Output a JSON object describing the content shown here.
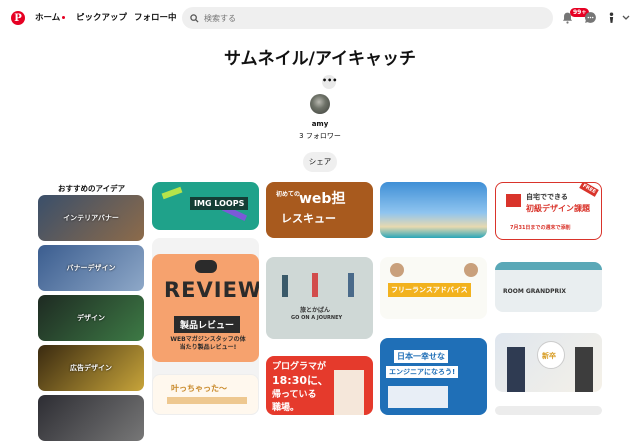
{
  "header": {
    "logo": "P",
    "nav": [
      "ホーム",
      "ピックアップ",
      "フォロー中"
    ],
    "search_placeholder": "検索する",
    "notification_count": "99+"
  },
  "board": {
    "title": "サムネイル/アイキャッチ",
    "more_label": "•••",
    "owner": "amy",
    "followers": "3 フォロワー",
    "share_label": "シェア"
  },
  "ideas": {
    "label": "おすすめのアイデア",
    "items": [
      "インテリアバナー",
      "バナーデザイン",
      "デザイン",
      "広告デザイン",
      ""
    ]
  },
  "pins": {
    "col1": {
      "a": "IMG LOOPS"
    },
    "col2": {
      "a_line1": "初めての",
      "a_line2": "web担",
      "a_line3": "レスキュー",
      "b": "REVIEW",
      "b_sub": "製品レビュー",
      "b_foot": "WEBマガジンスタッフの体当たり製品レビュー!",
      "c": "叶っちゃった〜"
    },
    "col3": {
      "a": "旅とかばん",
      "a_sub": "GO ON A JOURNEY",
      "b_line1": "プログラマが",
      "b_line2": "18:30に、",
      "b_line3": "帰っている",
      "b_line4": "職場。"
    },
    "col4": {
      "a": "フリーランスアドバイス",
      "b_line1": "日本一幸せな",
      "b_line2": "エンジニアになろう!"
    },
    "col5": {
      "a_line1": "自宅でできる",
      "a_line2": "初級デザイン課題",
      "a_foot": "7月31日までの週末で添削",
      "a_badge": "FREE",
      "b": "ROOM GRANDPRIX",
      "c": "新卒"
    }
  },
  "colors": {
    "brand": "#e60023"
  }
}
